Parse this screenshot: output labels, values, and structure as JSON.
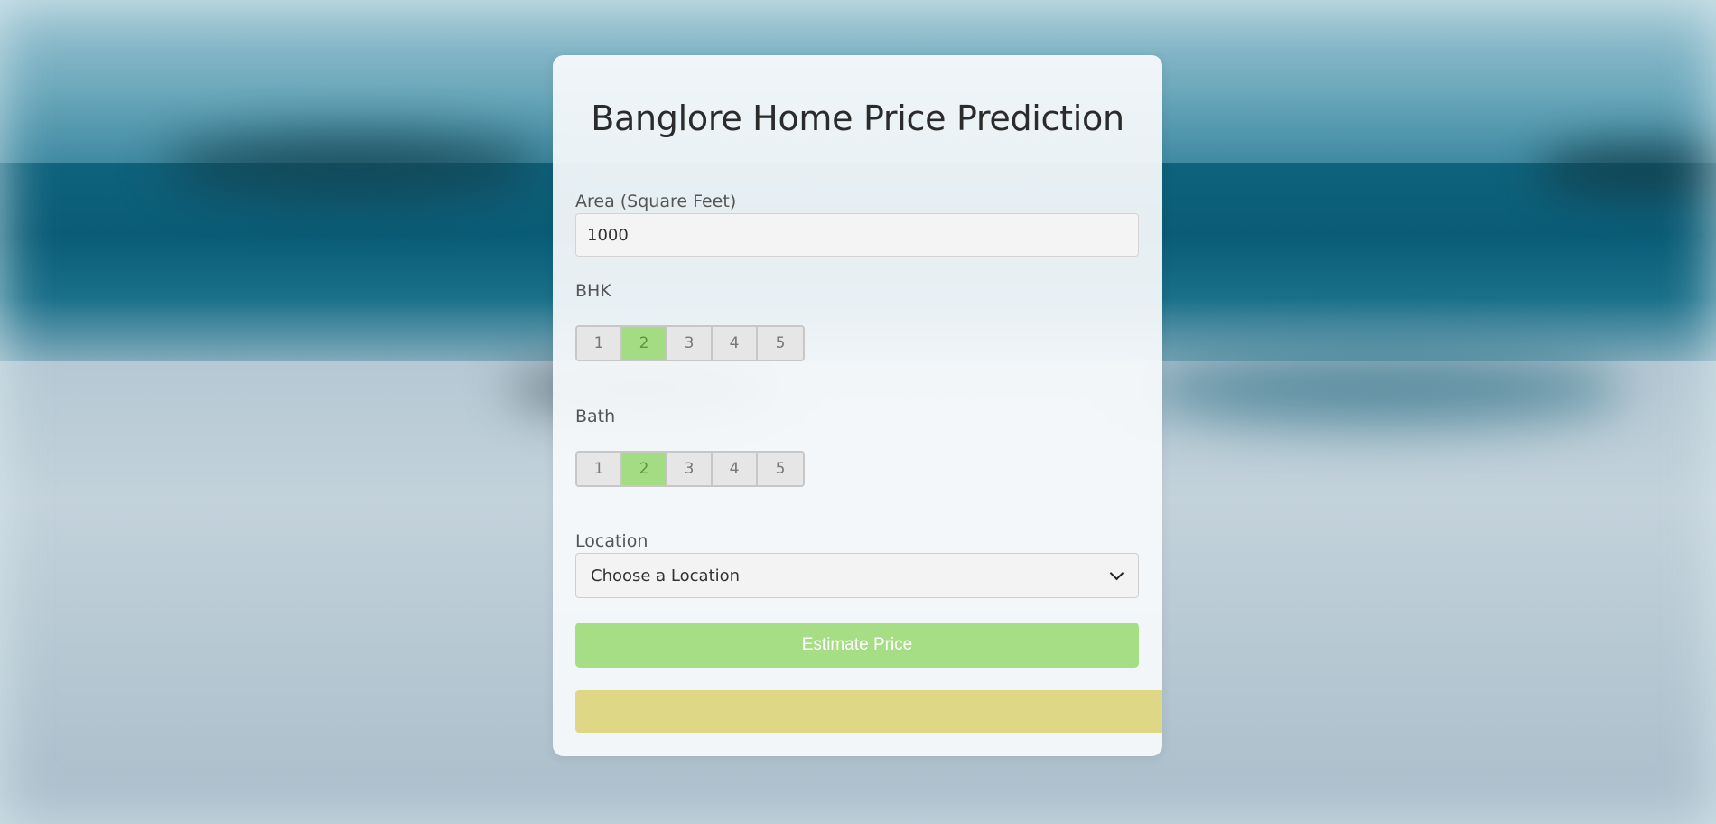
{
  "app": {
    "title": "Banglore Home Price Prediction"
  },
  "form": {
    "area": {
      "label": "Area (Square Feet)",
      "value": "1000"
    },
    "bhk": {
      "label": "BHK",
      "options": [
        "1",
        "2",
        "3",
        "4",
        "5"
      ],
      "selected": "2"
    },
    "bath": {
      "label": "Bath",
      "options": [
        "1",
        "2",
        "3",
        "4",
        "5"
      ],
      "selected": "2"
    },
    "location": {
      "label": "Location",
      "selected": "Choose a Location"
    },
    "submit_label": "Estimate Price",
    "result_text": ""
  },
  "colors": {
    "active_option": "#a3dc82",
    "button": "#a6de85",
    "result_box": "#ddd786"
  },
  "icons": {
    "select_arrow": "chevron-down-icon"
  }
}
